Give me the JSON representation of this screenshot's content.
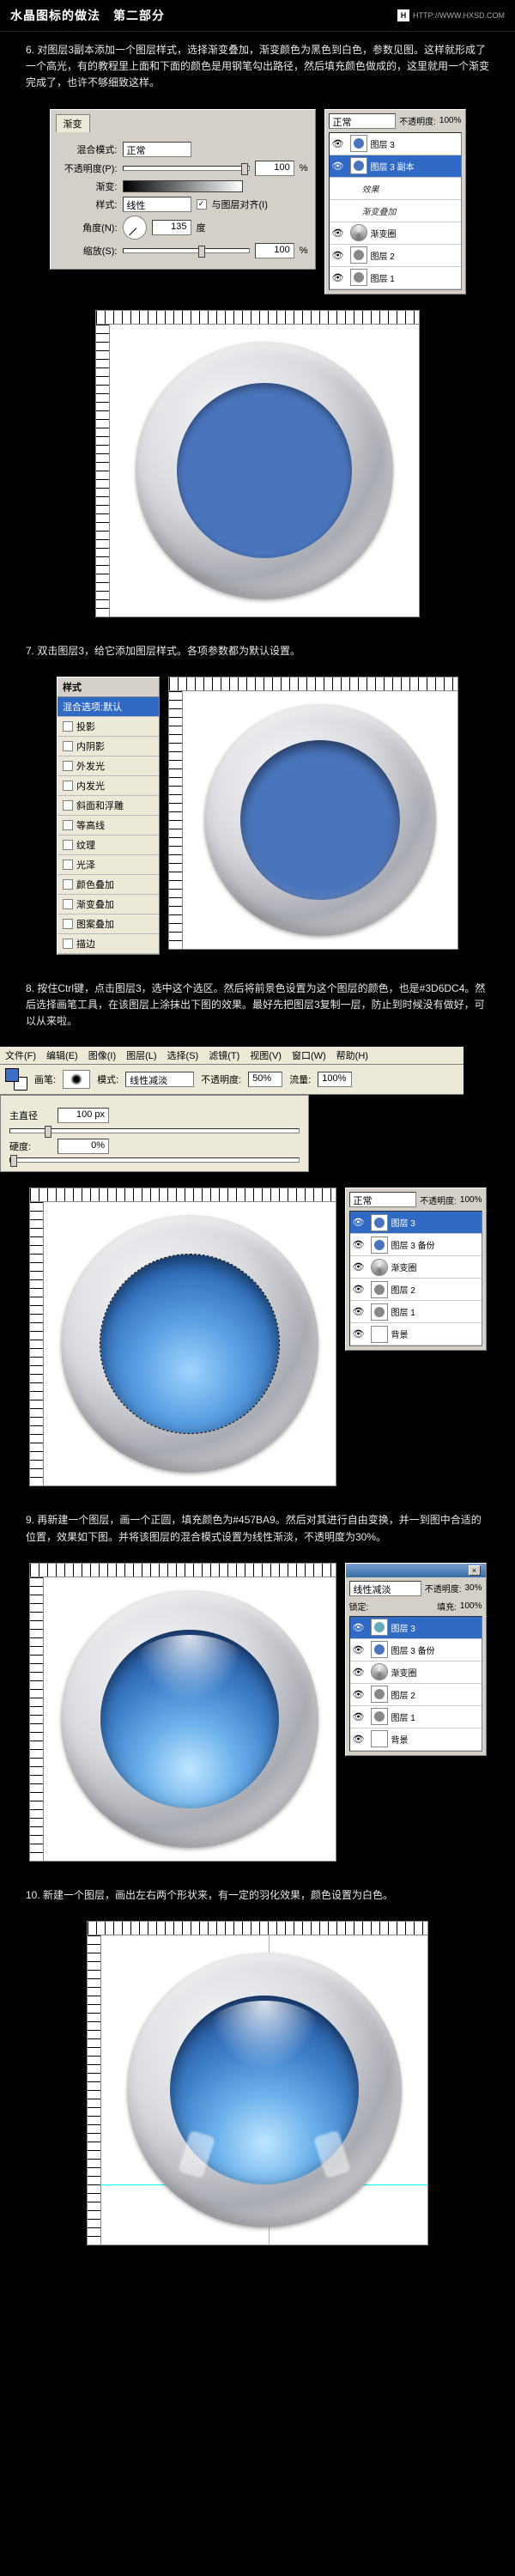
{
  "header": {
    "title": "水晶图标的做法　第二部分",
    "url": "HTTP://WWW.HXSD.COM",
    "logo": "H"
  },
  "steps": {
    "s6": "6. 对图层3副本添加一个图层样式，选择渐变叠加，渐变颜色为黑色到白色，参数见图。这样就形成了一个高光，有的教程里上面和下面的颜色是用钢笔勾出路径，然后填充颜色做成的，这里就用一个渐变完成了，也许不够细致这样。",
    "s7": "7. 双击图层3，给它添加图层样式。各项参数都为默认设置。",
    "s8": "8. 按住Ctrl键，点击图层3，选中这个选区。然后将前景色设置为这个图层的颜色，也是#3D6DC4。然后选择画笔工具，在该图层上涂抹出下图的效果。最好先把图层3复制一层，防止到时候没有做好，可以从来啦。",
    "s9": "9. 再新建一个图层，画一个正圆，填充颜色为#457BA9。然后对其进行自由变换，并一到图中合适的位置，效果如下图。并将该图层的混合模式设置为线性渐淡，不透明度为30%。",
    "s10": "10. 新建一个图层，画出左右两个形状来，有一定的羽化效果，颜色设置为白色。"
  },
  "panel6": {
    "tab": "渐变",
    "blend_lbl": "混合模式:",
    "blend_val": "正常",
    "opac_lbl": "不透明度(P):",
    "opac_val": "100",
    "pct": "%",
    "grad_lbl": "渐变:",
    "reverse_lbl": "与图层对齐(I)",
    "reverse_chk": "✓",
    "style_lbl": "样式:",
    "style_val": "线性",
    "angle_lbl": "角度(N):",
    "angle_val": "135",
    "deg": "度",
    "scale_lbl": "缩放(S):",
    "scale_val": "100"
  },
  "layers_labels": {
    "opac": "不透明度:",
    "opac_val": "100%",
    "blend": "正常"
  },
  "layers6": [
    {
      "name": "图层 3",
      "thumb": "#4a75bd"
    },
    {
      "name": "图层 3 副本",
      "sel": true,
      "thumb": "#4a75bd"
    },
    {
      "name": "效果",
      "indent": true,
      "fx": true
    },
    {
      "name": "渐变叠加",
      "indent": true,
      "fx": true
    },
    {
      "name": "渐变圈",
      "thumb": "grad"
    },
    {
      "name": "图层 2",
      "thumb": "#888"
    },
    {
      "name": "图层 1",
      "thumb": "#888"
    }
  ],
  "styles7": {
    "hdr": "样式",
    "head": "混合选项:默认",
    "items": [
      "投影",
      "内阴影",
      "外发光",
      "内发光",
      "斜面和浮雕",
      "等高线",
      "纹理",
      "光泽",
      "颜色叠加",
      "渐变叠加",
      "图案叠加",
      "描边"
    ]
  },
  "menu8": [
    "文件(F)",
    "编辑(E)",
    "图像(I)",
    "图层(L)",
    "选择(S)",
    "滤镜(T)",
    "视图(V)",
    "窗口(W)",
    "帮助(H)"
  ],
  "tool8": {
    "brush_lbl": "画笔:",
    "mode_lbl": "模式:",
    "mode_val": "线性减淡",
    "opac_lbl": "不透明度:",
    "opac_val": "50%",
    "flow_lbl": "流量:",
    "flow_val": "100%",
    "diam_lbl": "主直径",
    "diam_val": "100 px",
    "hard_lbl": "硬度:",
    "hard_val": "0%"
  },
  "layers8": [
    {
      "name": "图层 3",
      "sel": true,
      "thumb": "#4a75bd"
    },
    {
      "name": "图层 3 备份",
      "thumb": "#4a75bd"
    },
    {
      "name": "渐变圈",
      "thumb": "grad"
    },
    {
      "name": "图层 2",
      "thumb": "#888"
    },
    {
      "name": "图层 1",
      "thumb": "#888"
    },
    {
      "name": "背景",
      "thumb": "#fff"
    }
  ],
  "panel9": {
    "mode": "线性减淡",
    "opac_lbl": "不透明度:",
    "opac_val": "30%",
    "lock_lbl": "锁定:",
    "fill_lbl": "填充:",
    "fill_val": "100%"
  },
  "layers9": [
    {
      "name": "图层 3",
      "sel": true,
      "thumb": "#6ab"
    },
    {
      "name": "图层 3 备份",
      "thumb": "#4a75bd"
    },
    {
      "name": "渐变圈",
      "thumb": "grad"
    },
    {
      "name": "图层 2",
      "thumb": "#888"
    },
    {
      "name": "图层 1",
      "thumb": "#888"
    },
    {
      "name": "背景",
      "thumb": "#fff"
    }
  ],
  "eye": "👁"
}
